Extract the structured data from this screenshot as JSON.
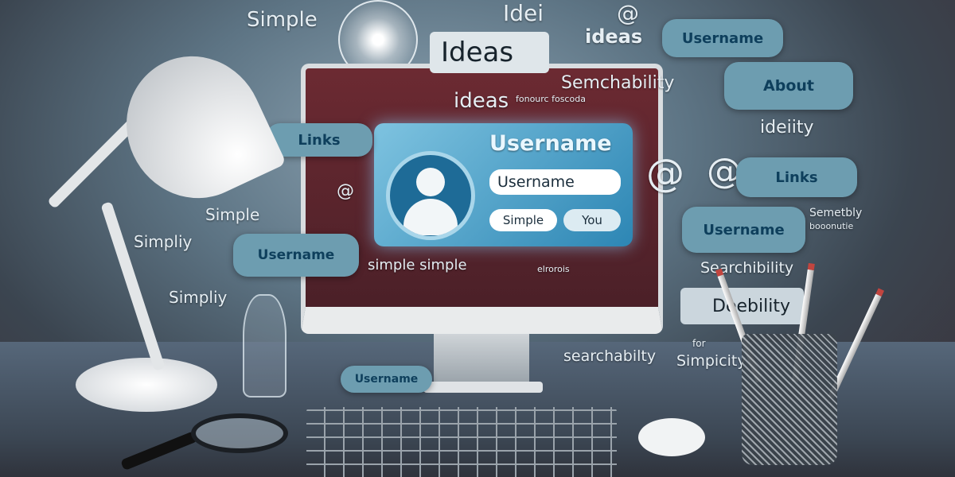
{
  "floating_text": {
    "simple_top": "Simple",
    "idei": "Idei",
    "ideas_right": "ideas",
    "ideas_mid": "ideas",
    "semchability": "Semchability",
    "fonourc": "fonourc foscoda",
    "ideity": "ideiity",
    "simple_left": "Simple",
    "simpliy": "Simpliy",
    "simply_bottom": "Simpliy",
    "simple_simple": "simple simple",
    "elrorois": "elrorois",
    "semetbly": "Semetbly",
    "semetbly_sub": "booonutie",
    "searchibility": "Searchibility",
    "searchabilty": "searchabilty",
    "for": "for",
    "simpicity": "Simpicity"
  },
  "windows": {
    "ideas": "Ideas",
    "deebility": "Deebility"
  },
  "pills": {
    "username_top": "Username",
    "about": "About",
    "links_left": "Links",
    "links_right": "Links",
    "username_right": "Username",
    "username_left": "Username",
    "username_bottom": "Username"
  },
  "profile_card": {
    "title": "Username",
    "input_value": "Username",
    "tag1": "Simple",
    "tag2": "You"
  },
  "icons": {
    "at": "@"
  },
  "colors": {
    "accent": "#6d9db0",
    "card": "#2d86b4",
    "text_dark": "#0e3f5c"
  }
}
